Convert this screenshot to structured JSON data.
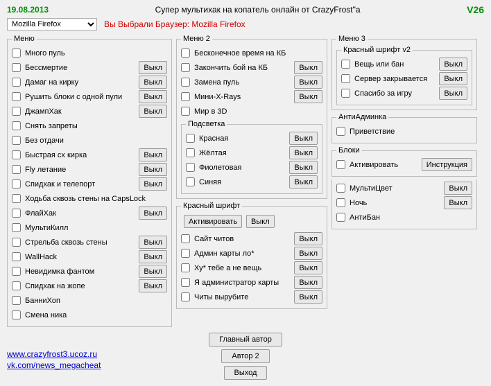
{
  "header": {
    "date": "19.08.2013",
    "title": "Супер мультихак на копатель онлайн от CrazyFrost\"a",
    "version": "V26"
  },
  "browser": {
    "selected": "Mozilla Firefox",
    "chosen_text": "Вы Выбрали Браузер: Mozilla Firefox"
  },
  "labels": {
    "off": "Выкл",
    "instruction": "Инструкция",
    "activate": "Активировать",
    "main_author": "Главный автор",
    "author2": "Автор 2",
    "exit": "Выход"
  },
  "menu1": {
    "legend": "Меню",
    "items": [
      {
        "label": "Много пуль",
        "btn": null
      },
      {
        "label": "Бессмертие",
        "btn": "off"
      },
      {
        "label": "Дамаг на кирку",
        "btn": "off"
      },
      {
        "label": "Рушить блоки с одной пули",
        "btn": "off"
      },
      {
        "label": "ДжампХак",
        "btn": "off"
      },
      {
        "label": "Снять запреты",
        "btn": null
      },
      {
        "label": "Без отдачи",
        "btn": null
      },
      {
        "label": "Быстрая сх кирка",
        "btn": "off"
      },
      {
        "label": "Fly летание",
        "btn": "off"
      },
      {
        "label": "Спидхак и телепорт",
        "btn": "off"
      },
      {
        "label": "Ходьба сквозь стены на CapsLock",
        "btn": null
      },
      {
        "label": "ФлайХак",
        "btn": "off"
      },
      {
        "label": "МультиКилл",
        "btn": null
      },
      {
        "label": "Стрельба сквозь стены",
        "btn": "off"
      },
      {
        "label": "WallHack",
        "btn": "off"
      },
      {
        "label": "Невидимка фантом",
        "btn": "off"
      },
      {
        "label": "Спидхак на жопе",
        "btn": "off"
      },
      {
        "label": "БанниХоп",
        "btn": null
      },
      {
        "label": "Смена ника",
        "btn": null
      }
    ]
  },
  "menu2": {
    "legend": "Меню 2",
    "items": [
      {
        "label": "Бесконечное время на КБ",
        "btn": null
      },
      {
        "label": "Закончить бой на КБ",
        "btn": "off"
      },
      {
        "label": "Замена пуль",
        "btn": "off"
      },
      {
        "label": "Мини-X-Rays",
        "btn": "off"
      },
      {
        "label": "Мир в 3D",
        "btn": null
      }
    ]
  },
  "highlight": {
    "legend": "Подсветка",
    "items": [
      {
        "label": "Красная",
        "btn": "off"
      },
      {
        "label": "Жёлтая",
        "btn": "off"
      },
      {
        "label": "Фиолетовая",
        "btn": "off"
      },
      {
        "label": "Синяя",
        "btn": "off"
      }
    ]
  },
  "redfont": {
    "legend": "Красный шрифт",
    "items": [
      {
        "label": "Сайт читов",
        "btn": "off"
      },
      {
        "label": "Админ карты ло*",
        "btn": "off"
      },
      {
        "label": "Ху* тебе а не вещь",
        "btn": "off"
      },
      {
        "label": "Я администратор карты",
        "btn": "off"
      },
      {
        "label": "Читы вырубите",
        "btn": "off"
      }
    ]
  },
  "menu3": {
    "legend": "Меню 3",
    "sub_legend": "Красный шрифт v2",
    "sub_items": [
      {
        "label": "Вещь или бан",
        "btn": "off"
      },
      {
        "label": "Сервер закрывается",
        "btn": "off"
      },
      {
        "label": "Спасибо за игру",
        "btn": "off"
      }
    ]
  },
  "antiadmin": {
    "legend": "АнтиАдминка",
    "items": [
      {
        "label": "Приветствие",
        "btn": null
      }
    ]
  },
  "blocks": {
    "legend": "Блоки",
    "items": [
      {
        "label": "Активировать",
        "btn": "instruction"
      }
    ]
  },
  "extra3": {
    "items": [
      {
        "label": "МультиЦвет",
        "btn": "off"
      },
      {
        "label": "Ночь",
        "btn": "off"
      },
      {
        "label": "АнтиБан",
        "btn": null
      }
    ]
  },
  "links": {
    "site": "www.crazyfrost3.ucoz.ru",
    "vk": "vk.com/news_megacheat"
  }
}
